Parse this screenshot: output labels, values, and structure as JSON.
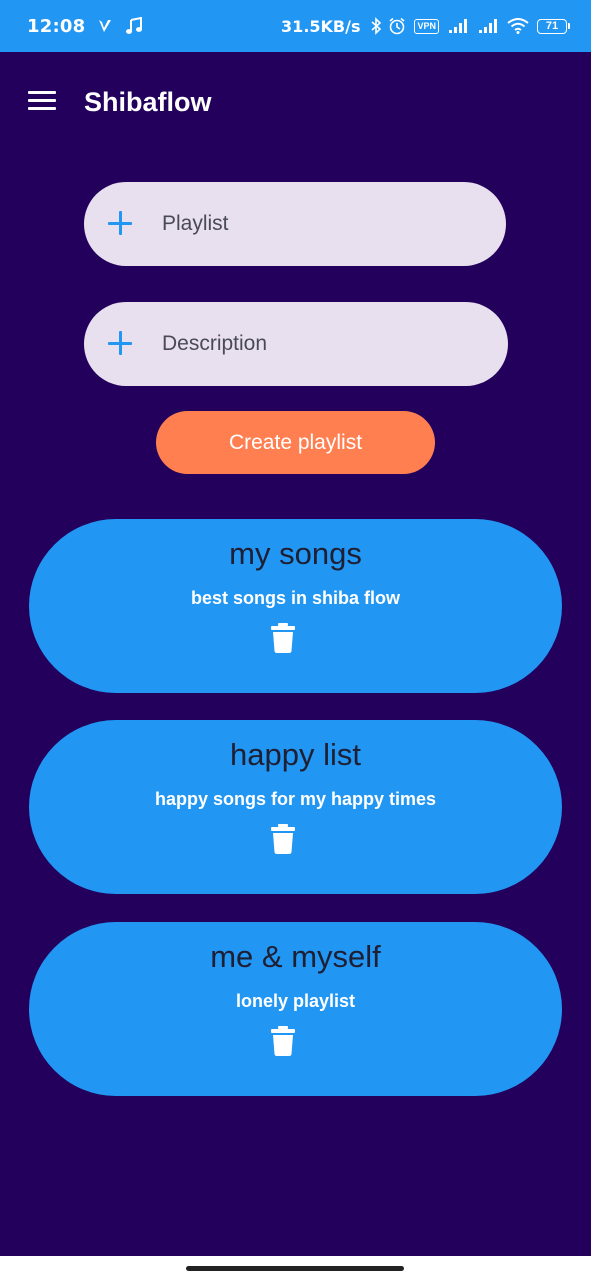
{
  "status_bar": {
    "time": "12:08",
    "network_speed": "31.5KB/s",
    "vpn_label": "VPN",
    "battery_level": "71",
    "icons": [
      "v-logo-icon",
      "music-note-icon",
      "bluetooth-icon",
      "alarm-icon",
      "signal-icon",
      "wifi-icon",
      "battery-icon"
    ],
    "color": "#2196f3"
  },
  "app_bar": {
    "title": "Shibaflow",
    "menu_icon": "hamburger-menu-icon"
  },
  "form": {
    "playlist_placeholder": "Playlist",
    "playlist_value": "",
    "description_placeholder": "Description",
    "description_value": "",
    "create_button_label": "Create playlist"
  },
  "playlists": [
    {
      "name": "my songs",
      "description": "best songs in shiba flow"
    },
    {
      "name": "happy list",
      "description": "happy songs for my happy times"
    },
    {
      "name": "me & myself",
      "description": "lonely playlist"
    }
  ],
  "colors": {
    "background": "#23005c",
    "accent": "#2196f3",
    "button": "#ff7f50",
    "input_fill": "#e8e0ee"
  }
}
